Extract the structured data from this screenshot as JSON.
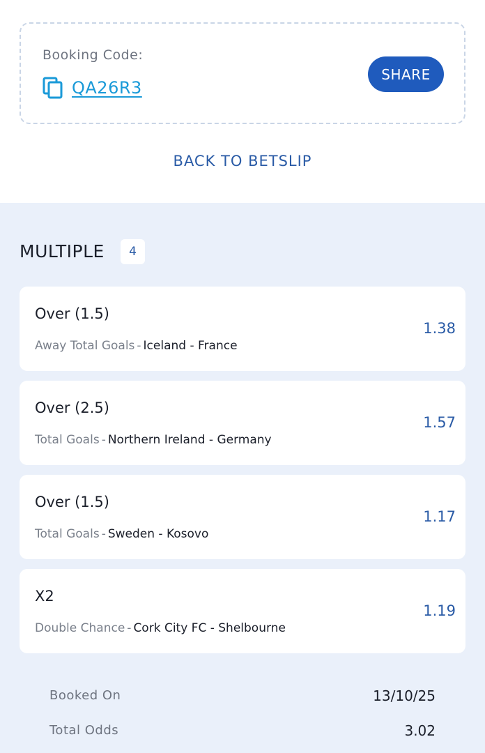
{
  "booking": {
    "label": "Booking Code:",
    "code": "QA26R3",
    "share_label": "SHARE",
    "copy_icon": "copy-icon",
    "accent": "#1f5bbd",
    "link_color": "#1a9ad8"
  },
  "back_label": "BACK TO BETSLIP",
  "multiple": {
    "title": "MULTIPLE",
    "count": "4"
  },
  "selections": [
    {
      "pick": "Over (1.5)",
      "market": "Away Total Goals",
      "event": "Iceland - France",
      "odds": "1.38"
    },
    {
      "pick": "Over (2.5)",
      "market": "Total Goals",
      "event": "Northern Ireland - Germany",
      "odds": "1.57"
    },
    {
      "pick": "Over (1.5)",
      "market": "Total Goals",
      "event": "Sweden - Kosovo",
      "odds": "1.17"
    },
    {
      "pick": "X2",
      "market": "Double Chance",
      "event": "Cork City FC - Shelbourne",
      "odds": "1.19"
    }
  ],
  "summary": {
    "booked_on_label": "Booked On",
    "booked_on_value": "13/10/25",
    "total_odds_label": "Total Odds",
    "total_odds_value": "3.02"
  }
}
